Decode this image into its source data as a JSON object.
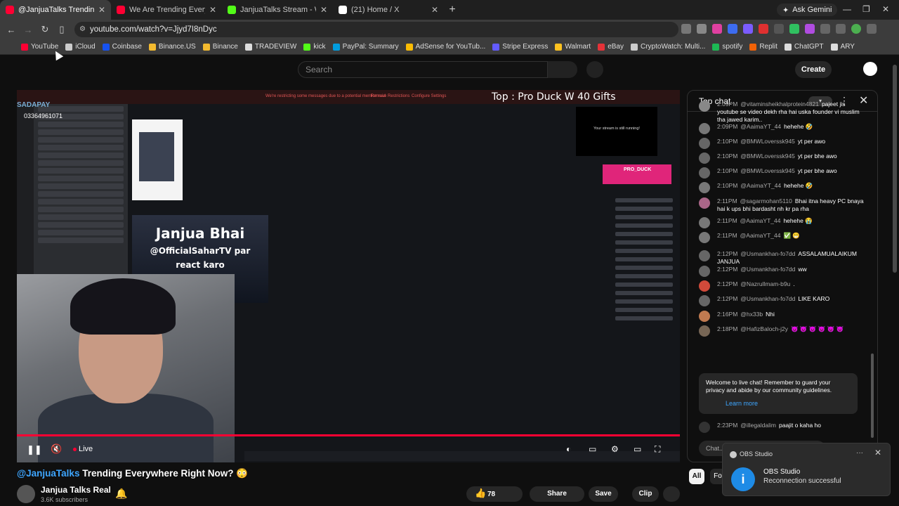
{
  "browser": {
    "tabs": [
      {
        "title": "@JanjuaTalks Trending Everywhere",
        "color": "#ff0033",
        "active": true
      },
      {
        "title": "We Are Trending Everywhere R",
        "color": "#ff0033",
        "active": false
      },
      {
        "title": "JanjuaTalks Stream - Watch Live",
        "color": "#53fc18",
        "active": false
      },
      {
        "title": "(21) Home / X",
        "color": "#ffffff",
        "active": false
      }
    ],
    "new_tab": "+",
    "ask_gemini": "Ask Gemini",
    "url": "youtube.com/watch?v=Jjyd7I8nDyc",
    "bookmarks": [
      {
        "label": "YouTube",
        "color": "#ff0033"
      },
      {
        "label": "iCloud",
        "color": "#cccccc"
      },
      {
        "label": "Coinbase",
        "color": "#1652f0"
      },
      {
        "label": "Binance.US",
        "color": "#f3ba2f"
      },
      {
        "label": "Binance",
        "color": "#f3ba2f"
      },
      {
        "label": "TRADEVIEW",
        "color": "#dddddd"
      },
      {
        "label": "kick",
        "color": "#53fc18"
      },
      {
        "label": "PayPal: Summary",
        "color": "#009cde"
      },
      {
        "label": "AdSense for YouTub...",
        "color": "#fbbc04"
      },
      {
        "label": "Stripe Express",
        "color": "#635bff"
      },
      {
        "label": "Walmart",
        "color": "#ffc220"
      },
      {
        "label": "eBay",
        "color": "#e53238"
      },
      {
        "label": "CryptoWatch: Multi...",
        "color": "#cccccc"
      },
      {
        "label": "spotify",
        "color": "#1db954"
      },
      {
        "label": "Replit",
        "color": "#f26207"
      },
      {
        "label": "ChatGPT",
        "color": "#dddddd"
      },
      {
        "label": "ARY",
        "color": "#dddddd"
      }
    ]
  },
  "youtube": {
    "search_placeholder": "Search",
    "create_label": "Create"
  },
  "video": {
    "overlay_banner": {
      "left": "We're restricting some messages due to a potential mention raid",
      "mid": "Remove Restrictions",
      "right": "Configure Settings"
    },
    "sadapay": "SADAPAY",
    "phone": "03364961071",
    "card_line1": "Janjua Bhai",
    "card_line2": "@OfficialSaharTV par",
    "card_line3": "react karo",
    "top_gift": "Top : Pro Duck W 40 Gifts",
    "stream_notice": "Your stream is still running!",
    "pro_duck": "PRO_DUCK",
    "live_label": "Live"
  },
  "chat": {
    "title": "Top chat",
    "messages": [
      {
        "time": "2:09PM",
        "user": "@vitaminsheikhalprotein4821",
        "text": "pajeet jis youtube se video dekh rha hai uska founder vi muslim tha jawed karim..",
        "color": "#888888"
      },
      {
        "time": "2:09PM",
        "user": "@AaimaYT_44",
        "text": "hehehe 🤣",
        "color": "#777777"
      },
      {
        "time": "2:10PM",
        "user": "@BMWLoverssk945",
        "text": "yt per awo",
        "color": "#666666"
      },
      {
        "time": "2:10PM",
        "user": "@BMWLoverssk945",
        "text": "yt per bhe awo",
        "color": "#666666"
      },
      {
        "time": "2:10PM",
        "user": "@BMWLoverssk945",
        "text": "yt per bhe awo",
        "color": "#666666"
      },
      {
        "time": "2:10PM",
        "user": "@AaimaYT_44",
        "text": "hehehe 🤣",
        "color": "#777777"
      },
      {
        "time": "2:11PM",
        "user": "@sagarmohan5110",
        "text": "Bhai itna heavy PC bnaya hai k ups bhi bardasht nh kr pa rha",
        "color": "#aa6688"
      },
      {
        "time": "2:11PM",
        "user": "@AaimaYT_44",
        "text": "hehehe 😭",
        "color": "#777777"
      },
      {
        "time": "2:11PM",
        "user": "@AaimaYT_44",
        "text": "✅ 😁",
        "color": "#777777"
      },
      {
        "time": "2:12PM",
        "user": "@Usmankhan-fo7dd",
        "text": "ASSALAMUALAIKUM JANJUA",
        "color": "#666666"
      },
      {
        "time": "2:12PM",
        "user": "@Usmankhan-fo7dd",
        "text": "ww",
        "color": "#666666"
      },
      {
        "time": "2:12PM",
        "user": "@Nazrullmam-b9u",
        "text": ".",
        "color": "#d04a3a"
      },
      {
        "time": "2:12PM",
        "user": "@Usmankhan-fo7dd",
        "text": "LIKE KARO",
        "color": "#666666"
      },
      {
        "time": "2:16PM",
        "user": "@hx33b",
        "text": "Nhi",
        "color": "#c07a50"
      },
      {
        "time": "2:18PM",
        "user": "@HafizBaloch-j2y",
        "text": "😈 😈 😈 😈 😈 😈",
        "color": "#776655"
      }
    ],
    "welcome": "Welcome to live chat! Remember to guard your privacy and abide by our community guidelines.",
    "learn_more": "Learn more",
    "last_message": {
      "time": "2:23PM",
      "user": "@illegaldalim",
      "text": "paajit o kaha ho",
      "color": "#333333"
    },
    "input_placeholder": "Chat..."
  },
  "below": {
    "handle": "@JanjuaTalks",
    "title": " Trending Everywhere Right Now? 😳",
    "channel": "Janjua Talks Real",
    "subscribers": "3.6K subscribers",
    "likes": "78",
    "share": "Share",
    "save": "Save",
    "clip": "Clip",
    "filter_all": "All",
    "filter_f": "Fo"
  },
  "toast": {
    "app": "OBS Studio",
    "title": "OBS Studio",
    "body": "Reconnection successful"
  }
}
